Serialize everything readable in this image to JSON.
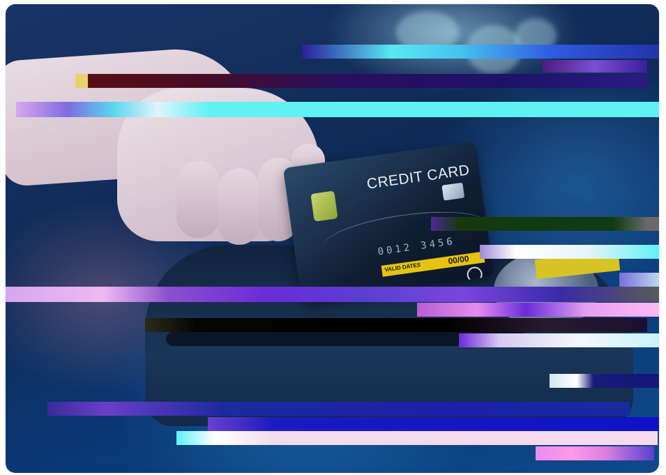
{
  "photo": {
    "subject": "hand-inserting-card-into-payment-terminal",
    "card_title": "CREDIT CARD",
    "card_number": "0012  3456",
    "valid_label": "VALID DATES",
    "valid_value": "00/00",
    "sticker_text": ""
  },
  "colors": {
    "accent_cyan": "#5ff2f5",
    "accent_magenta": "#e68cf0",
    "accent_purple": "#6a2bd8",
    "card_stripe": "#e4c40e"
  }
}
